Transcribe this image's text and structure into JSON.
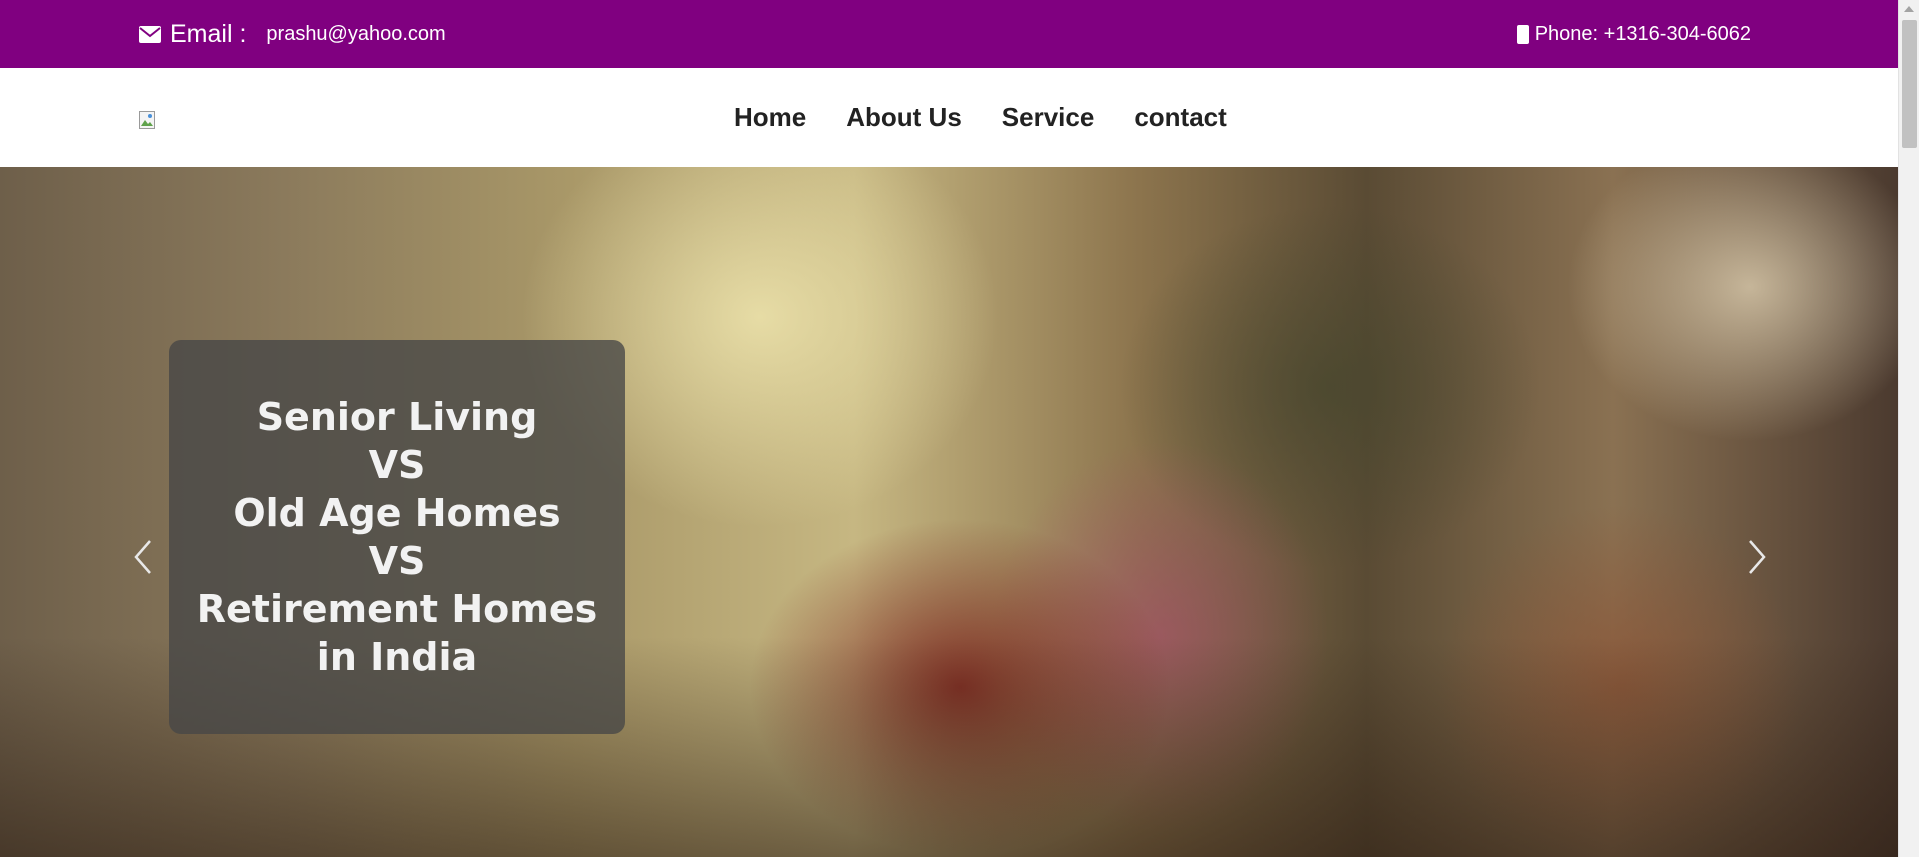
{
  "topbar": {
    "email_label": "Email :",
    "email_value": "prashu@yahoo.com",
    "phone_text": "Phone: +1316-304-6062",
    "background": "#800080"
  },
  "nav": {
    "items": [
      {
        "label": "Home"
      },
      {
        "label": "About Us"
      },
      {
        "label": "Service"
      },
      {
        "label": "contact"
      }
    ]
  },
  "hero": {
    "caption_lines": [
      "Senior Living",
      "VS",
      "Old Age Homes",
      "VS",
      "Retirement Homes",
      "in India"
    ],
    "prev_icon": "chevron-left-icon",
    "next_icon": "chevron-right-icon"
  },
  "icons": {
    "email": "envelope-icon",
    "phone": "mobile-phone-icon",
    "logo": "broken-image-icon"
  }
}
